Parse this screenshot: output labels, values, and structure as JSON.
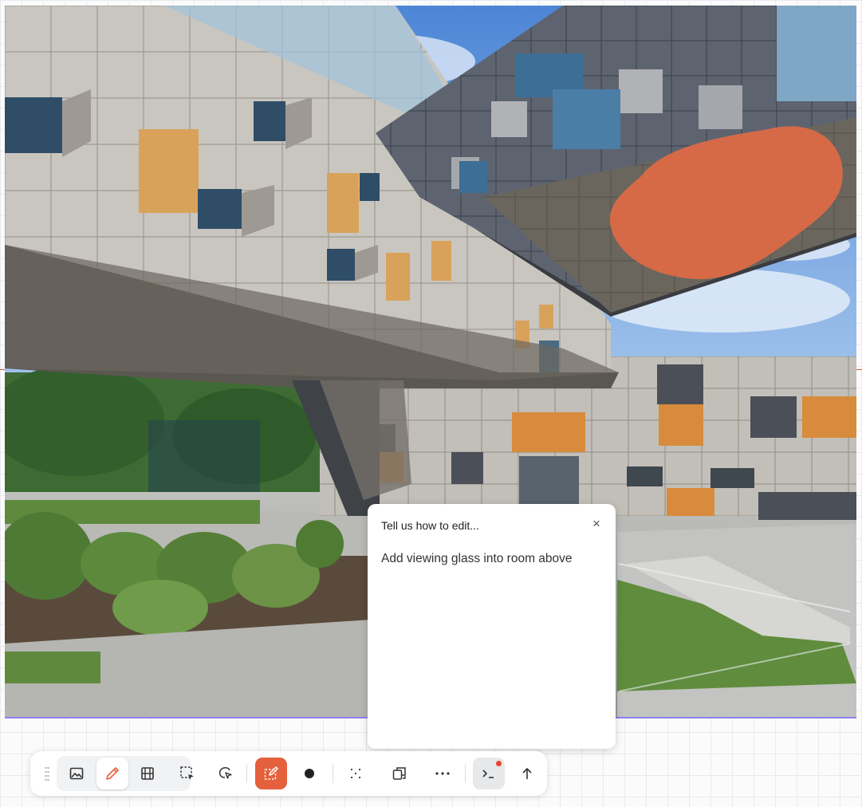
{
  "dialog": {
    "title": "Tell us how to edit...",
    "close_glyph": "×",
    "prompt_text": "Add viewing glass into room above"
  },
  "toolbar": {
    "tools": [
      {
        "name": "image-icon"
      },
      {
        "name": "pencil-icon",
        "selected": true
      },
      {
        "name": "film-icon"
      },
      {
        "name": "marquee-select-icon"
      },
      {
        "name": "lasso-select-icon"
      },
      {
        "name": "mask-edit-icon",
        "active": true
      },
      {
        "name": "brush-dot-icon"
      },
      {
        "name": "scatter-icon"
      },
      {
        "name": "copy-transform-icon"
      },
      {
        "name": "more-icon"
      },
      {
        "name": "terminal-icon",
        "has_notification": true
      },
      {
        "name": "upload-arrow-icon"
      }
    ]
  },
  "colors": {
    "accent": "#e5603c",
    "mask_overlay": "#df6a45",
    "canvas_border": "#8b80f0",
    "notification": "#e8452f"
  }
}
